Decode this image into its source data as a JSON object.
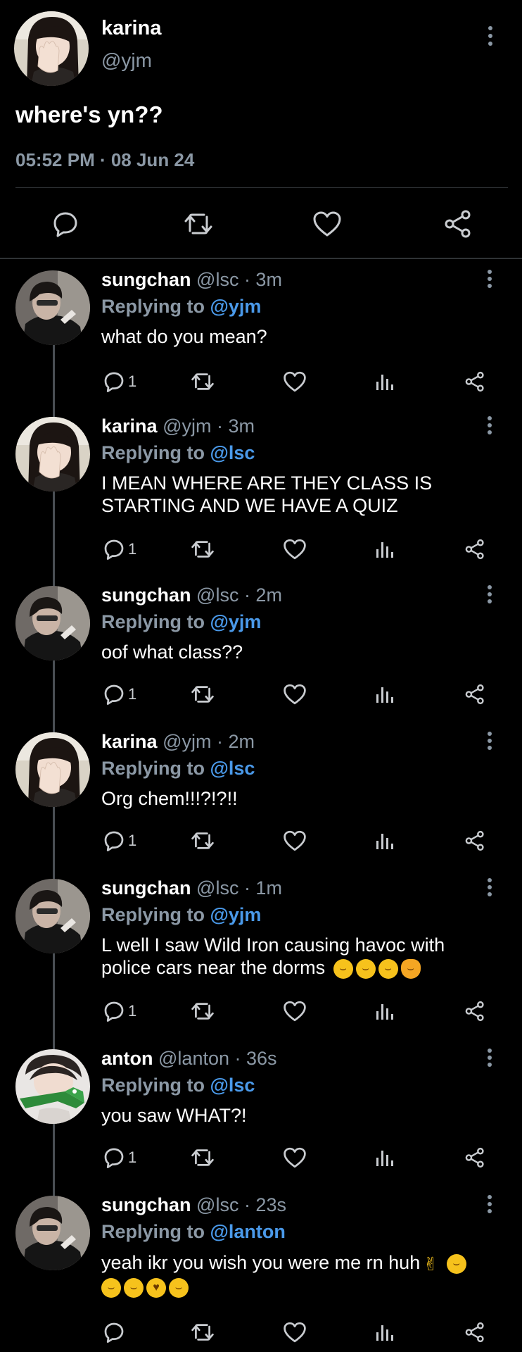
{
  "main_post": {
    "name": "karina",
    "handle": "@yjm",
    "text": "where's yn??",
    "timestamp": "05:52 PM · 08 Jun 24",
    "actions": [
      "reply-icon",
      "retweet-icon",
      "like-icon",
      "share-icon"
    ]
  },
  "replies": [
    {
      "name": "sungchan",
      "handle_time": "@lsc · 3m",
      "replying_prefix": "Replying to ",
      "replying_to": "@yjm",
      "text": "what do you mean?",
      "reply_count": "1",
      "avatar": "sungchan"
    },
    {
      "name": "karina",
      "handle_time": "@yjm · 3m",
      "replying_prefix": "Replying to ",
      "replying_to": "@lsc",
      "text": "I MEAN WHERE ARE THEY CLASS IS STARTING AND WE HAVE A QUIZ",
      "reply_count": "1",
      "avatar": "karina"
    },
    {
      "name": "sungchan",
      "handle_time": "@lsc · 2m",
      "replying_prefix": "Replying to ",
      "replying_to": "@yjm",
      "text": "oof what class??",
      "reply_count": "1",
      "avatar": "sungchan"
    },
    {
      "name": "karina",
      "handle_time": "@yjm · 2m",
      "replying_prefix": "Replying to ",
      "replying_to": "@lsc",
      "text": "Org chem!!!?!?!!",
      "reply_count": "1",
      "avatar": "karina"
    },
    {
      "name": "sungchan",
      "handle_time": "@lsc · 1m",
      "replying_prefix": "Replying to ",
      "replying_to": "@yjm",
      "text": "L well I saw Wild Iron causing havoc with police cars near the dorms",
      "reply_count": "1",
      "avatar": "sungchan",
      "emojis": [
        "grinning-squinting",
        "rolling-laughing",
        "tears-of-joy",
        "cat-laughing"
      ]
    },
    {
      "name": "anton",
      "handle_time": "@lanton · 36s",
      "replying_prefix": "Replying to ",
      "replying_to": "@lsc",
      "text": "you saw WHAT?!",
      "reply_count": "1",
      "avatar": "anton"
    },
    {
      "name": "sungchan",
      "handle_time": "@lsc · 23s",
      "replying_prefix": "Replying to ",
      "replying_to": "@lanton",
      "text": "yeah ikr you wish you were me rn huh",
      "reply_count": "",
      "avatar": "sungchan",
      "emojis": [
        "crossed-fingers",
        "smirking",
        "relieved",
        "slightly-smiling",
        "kissing",
        "winking"
      ]
    }
  ],
  "colors": {
    "background": "#000000",
    "muted_text": "#8b98a5",
    "link_blue": "#4a99e9",
    "icon_gray": "#c9ccd0",
    "divider": "#2f3336"
  }
}
